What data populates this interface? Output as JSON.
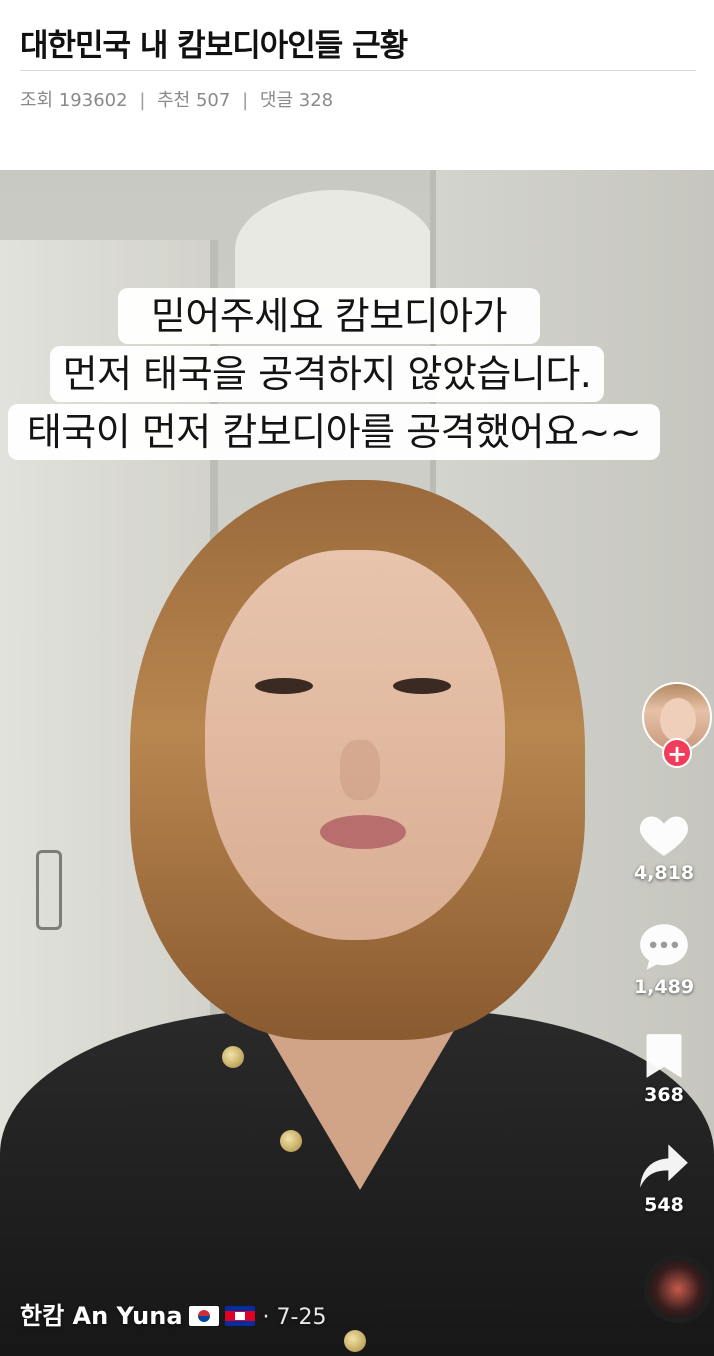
{
  "post": {
    "title": "대한민국 내 캄보디아인들 근황",
    "stats": {
      "views_label": "조회",
      "views": "193602",
      "recommend_label": "추천",
      "recommend": "507",
      "comments_label": "댓글",
      "comments": "328",
      "separator": "|"
    }
  },
  "video": {
    "caption_lines": [
      "믿어주세요 캄보디아가",
      "먼저 태국을 공격하지 않았습니다.",
      "태국이 먼저 캄보디아를 공격했어요~~"
    ],
    "author": "한캄 An Yuna",
    "date": "· 7-25",
    "follow_symbol": "+",
    "actions": {
      "likes": "4,818",
      "comments": "1,489",
      "saves": "368",
      "shares": "548"
    },
    "colors": {
      "follow": "#f23c5c",
      "icon": "#ffffff"
    }
  }
}
